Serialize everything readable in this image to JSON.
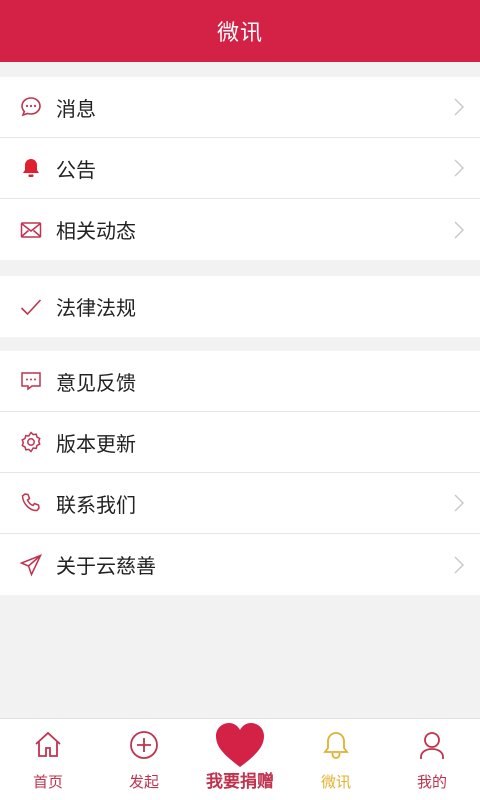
{
  "header": {
    "title": "微讯"
  },
  "groups": [
    {
      "items": [
        {
          "label": "消息",
          "icon": "chat-bubble-icon",
          "chevron": true
        },
        {
          "label": "公告",
          "icon": "bell-icon",
          "chevron": true
        },
        {
          "label": "相关动态",
          "icon": "envelope-icon",
          "chevron": true
        }
      ]
    },
    {
      "items": [
        {
          "label": "法律法规",
          "icon": "checkmark-icon",
          "chevron": false
        }
      ]
    },
    {
      "items": [
        {
          "label": "意见反馈",
          "icon": "feedback-icon",
          "chevron": false
        },
        {
          "label": "版本更新",
          "icon": "gear-icon",
          "chevron": false
        },
        {
          "label": "联系我们",
          "icon": "phone-icon",
          "chevron": true
        },
        {
          "label": "关于云慈善",
          "icon": "send-icon",
          "chevron": true
        }
      ]
    }
  ],
  "tabbar": {
    "items": [
      {
        "label": "首页",
        "icon": "home-icon",
        "active": false
      },
      {
        "label": "发起",
        "icon": "plus-circle-icon",
        "active": false
      },
      {
        "label": "我要捐赠",
        "icon": "heart-icon",
        "active": false
      },
      {
        "label": "微讯",
        "icon": "bell-icon",
        "active": true
      },
      {
        "label": "我的",
        "icon": "user-icon",
        "active": false
      }
    ]
  },
  "colors": {
    "brand": "#d42246",
    "accent": "#c0334e",
    "active_tab": "#e0b030"
  }
}
